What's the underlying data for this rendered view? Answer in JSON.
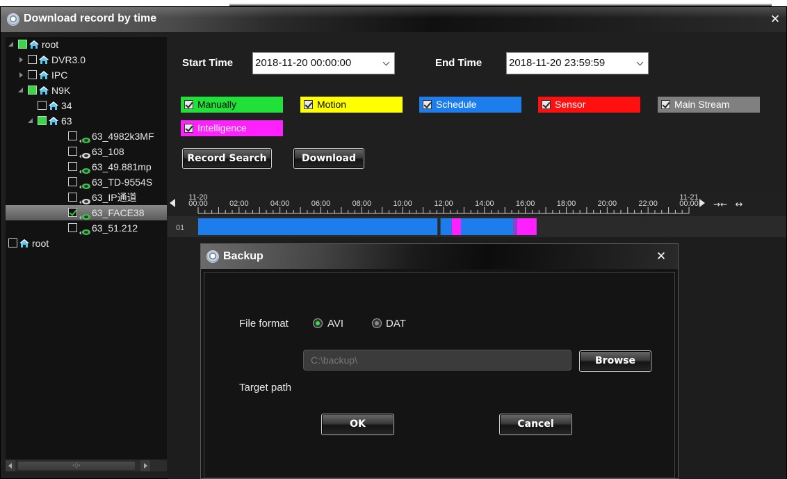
{
  "window": {
    "title": "Download record by time",
    "close_glyph": "✕",
    "logo_icon": "camera-logo-icon"
  },
  "tree": {
    "nodes": [
      {
        "label": "root"
      },
      {
        "label": "DVR3.0"
      },
      {
        "label": "IPC"
      },
      {
        "label": "N9K"
      },
      {
        "label": "34"
      },
      {
        "label": "63"
      },
      {
        "label": "63_4982k3MF"
      },
      {
        "label": "63_108"
      },
      {
        "label": "63_49.881mp"
      },
      {
        "label": "63_TD-9554S"
      },
      {
        "label": "63_IP通道"
      },
      {
        "label": "63_FACE38"
      },
      {
        "label": "63_51.212"
      },
      {
        "label": "root"
      }
    ],
    "scroll_thumb_glyph": "‹◊›"
  },
  "search": {
    "start_label": "Start Time",
    "start_value": "2018-11-20 00:00:00",
    "end_label": "End Time",
    "end_value": "2018-11-20 23:59:59"
  },
  "filters": [
    {
      "label": "Manually",
      "color": "#22e03a"
    },
    {
      "label": "Motion",
      "color": "#ffff00"
    },
    {
      "label": "Schedule",
      "color": "#1e7dec"
    },
    {
      "label": "Sensor",
      "color": "#ff1010"
    },
    {
      "label": "Main Stream",
      "color": "#808080"
    },
    {
      "label": "Intelligence",
      "color": "#ff20ff"
    }
  ],
  "buttons": {
    "record_search": "Record Search",
    "download": "Download"
  },
  "timeline": {
    "start_date": "11-20",
    "end_date": "11-21",
    "ticks": [
      "00:00",
      "02:00",
      "04:00",
      "06:00",
      "08:00",
      "10:00",
      "12:00",
      "14:00",
      "16:00",
      "18:00",
      "20:00",
      "22:00",
      "00:00"
    ],
    "channel": "01",
    "zoom_in_glyph": "→←",
    "zoom_out_glyph": "↔",
    "segments": [
      {
        "from_hour": 0.0,
        "to_hour": 11.7,
        "color": "#1e7dec"
      },
      {
        "from_hour": 11.85,
        "to_hour": 12.4,
        "color": "#1e7dec"
      },
      {
        "from_hour": 12.4,
        "to_hour": 12.85,
        "color": "#ff20ff"
      },
      {
        "from_hour": 12.85,
        "to_hour": 15.4,
        "color": "#1e7dec"
      },
      {
        "from_hour": 15.4,
        "to_hour": 15.6,
        "color": "#8844cc"
      },
      {
        "from_hour": 15.6,
        "to_hour": 16.55,
        "color": "#ff20ff"
      }
    ]
  },
  "backup": {
    "title": "Backup",
    "close_glyph": "✕",
    "file_format_label": "File format",
    "formats": [
      {
        "label": "AVI",
        "selected": true
      },
      {
        "label": "DAT",
        "selected": false
      }
    ],
    "target_path_label": "Target path",
    "target_path_value": "C:\\backup\\",
    "browse": "Browse",
    "ok": "OK",
    "cancel": "Cancel"
  }
}
